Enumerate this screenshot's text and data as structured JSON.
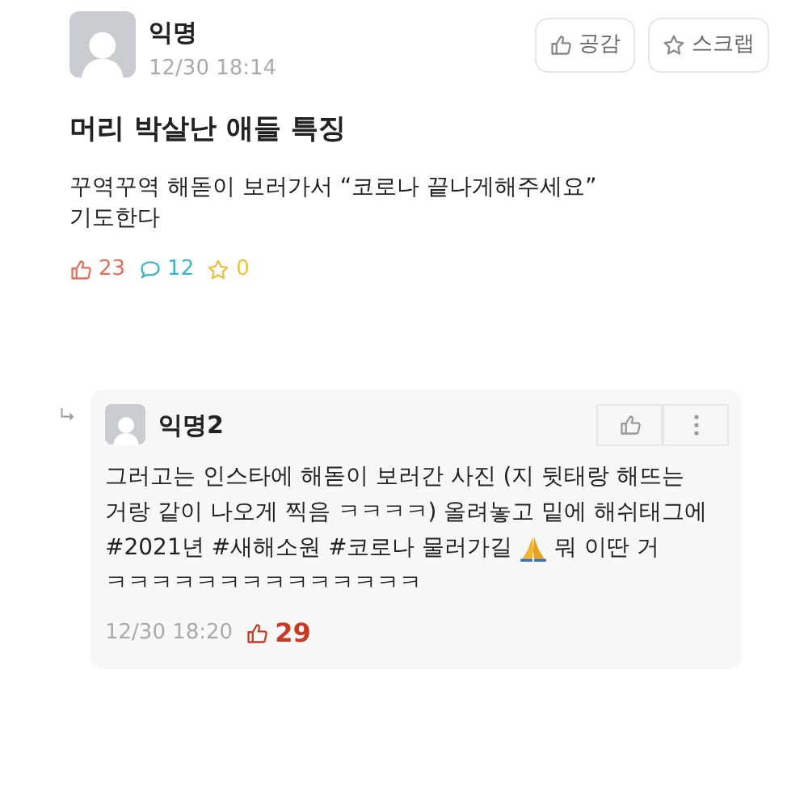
{
  "post": {
    "author": "익명",
    "time": "12/30 18:14",
    "actions": [
      {
        "kind": "like",
        "label": "공감"
      },
      {
        "kind": "scrap",
        "label": "스크랩"
      }
    ],
    "title": "머리 박살난 애들 특징",
    "body": [
      "꾸역꾸역 해돋이 보러가서 “코로나 끝나게해주세요”",
      "기도한다"
    ],
    "stats": [
      {
        "kind": "like",
        "count": "23",
        "color": "#e0705c"
      },
      {
        "kind": "comment",
        "count": "12",
        "color": "#3fb2c8"
      },
      {
        "kind": "scrap",
        "count": "0",
        "color": "#e6c23a"
      }
    ]
  },
  "comments": [
    {
      "author": "익명2",
      "time": "12/30 18:20",
      "likes": "29",
      "lines": [
        {
          "text": "그러고는 인스타에 해돋이 보러간 사진 (지 뒷태랑 해뜨는"
        },
        {
          "text": "거랑 같이 나오게 찍음 ㅋㅋㅋㅋ) 올려놓고 밑에 해쉬태그에"
        },
        {
          "text": "#2021년 #새해소원 #코로나 물러가길",
          "kind": "with_icon",
          "after": "뭐 이딴 거"
        },
        {
          "text": "ㅋㅋㅋㅋㅋㅋㅋㅋㅋㅋㅋㅋㅋㅋ"
        }
      ]
    }
  ]
}
